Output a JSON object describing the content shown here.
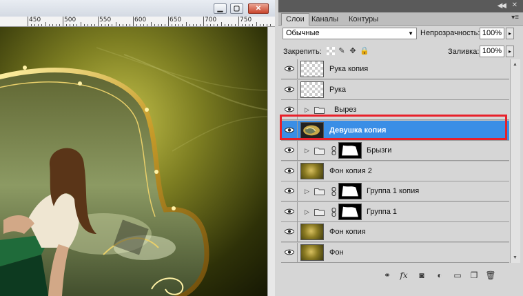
{
  "document": {
    "ruler": {
      "labels": [
        "450",
        "500",
        "550",
        "600",
        "650",
        "700",
        "750"
      ]
    },
    "window_buttons": {
      "minimize": "▁",
      "maximize": "▢",
      "close": "✕"
    }
  },
  "layers_panel": {
    "tabs": [
      "Слои",
      "Каналы",
      "Контуры"
    ],
    "blend_mode": "Обычные",
    "opacity_label": "Непрозрачность:",
    "opacity_value": "100%",
    "lock_label": "Закрепить:",
    "fill_label": "Заливка:",
    "fill_value": "100%",
    "layers": [
      {
        "name": "Рука копия",
        "thumb": "transparent"
      },
      {
        "name": "Рука",
        "thumb": "transparent"
      },
      {
        "name": "Вырез",
        "thumb": "folder"
      },
      {
        "name": "Девушка копия",
        "thumb": "image",
        "selected": true
      },
      {
        "name": "Брызги",
        "thumb": "folder-mask"
      },
      {
        "name": "Фон копия 2",
        "thumb": "olive"
      },
      {
        "name": "Группа 1 копия",
        "thumb": "folder-mask"
      },
      {
        "name": "Группа 1",
        "thumb": "folder-mask"
      },
      {
        "name": "Фон копия",
        "thumb": "olive"
      },
      {
        "name": "Фон",
        "thumb": "olive"
      }
    ],
    "highlight_color": "#e8202a",
    "selection_color": "#3a8ee6"
  }
}
